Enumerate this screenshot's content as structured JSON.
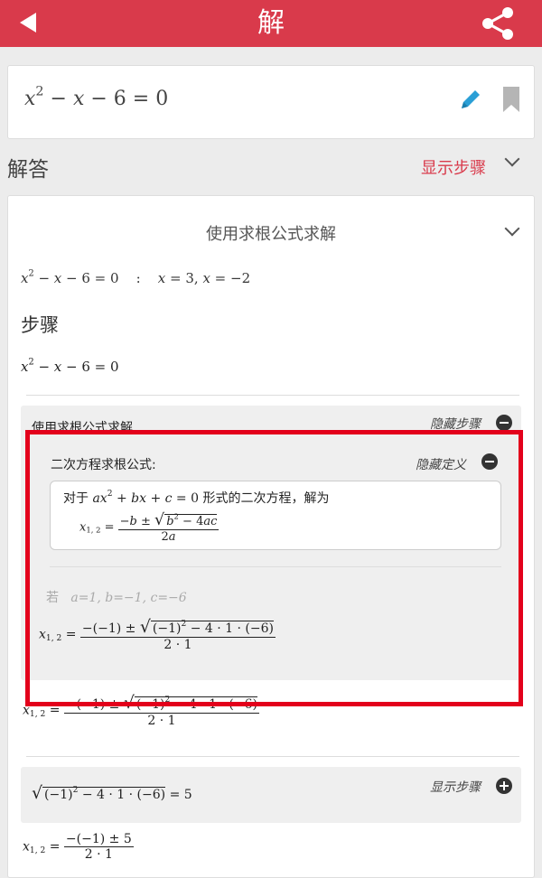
{
  "header": {
    "title": "解",
    "back_icon": "back-arrow-icon",
    "share_icon": "share-icon",
    "color": "#d93a4b"
  },
  "input": {
    "equation": "x²−x−6=0"
  },
  "solution": {
    "label": "解答",
    "show_steps": "显示步骤"
  },
  "main": {
    "method_title": "使用求根公式求解",
    "summary_eq": "x²−x−6=0",
    "summary_sep": ":",
    "summary_result": "x=3, x=−2",
    "steps_heading": "步骤",
    "step1_eq": "x²−x−6=0",
    "step_box": {
      "title": "使用求根公式求解",
      "hide_steps": "隐藏步骤"
    },
    "definition": {
      "title": "二次方程求根公式:",
      "hide_definition": "隐藏定义",
      "for_text": "对于",
      "form": "ax²+bx+c=0",
      "form_suffix": "形式的二次方程，解为",
      "x_label": "x1, 2 =",
      "numerator": "−b ± √(b²−4ac)",
      "denominator": "2a"
    },
    "if_label": "若",
    "params": "a=1, b=−1, c=−6",
    "sub_numerator": "−(−1) ± √((−1)²−4·1·(−6))",
    "sub_denominator": "2·1",
    "radical_expr": "√((−1)²−4·1·(−6)) = 5",
    "show_steps_2": "显示步骤",
    "final_numerator": "−(−1) ± 5",
    "final_denominator": "2·1"
  },
  "highlight_color": "#e3001b"
}
